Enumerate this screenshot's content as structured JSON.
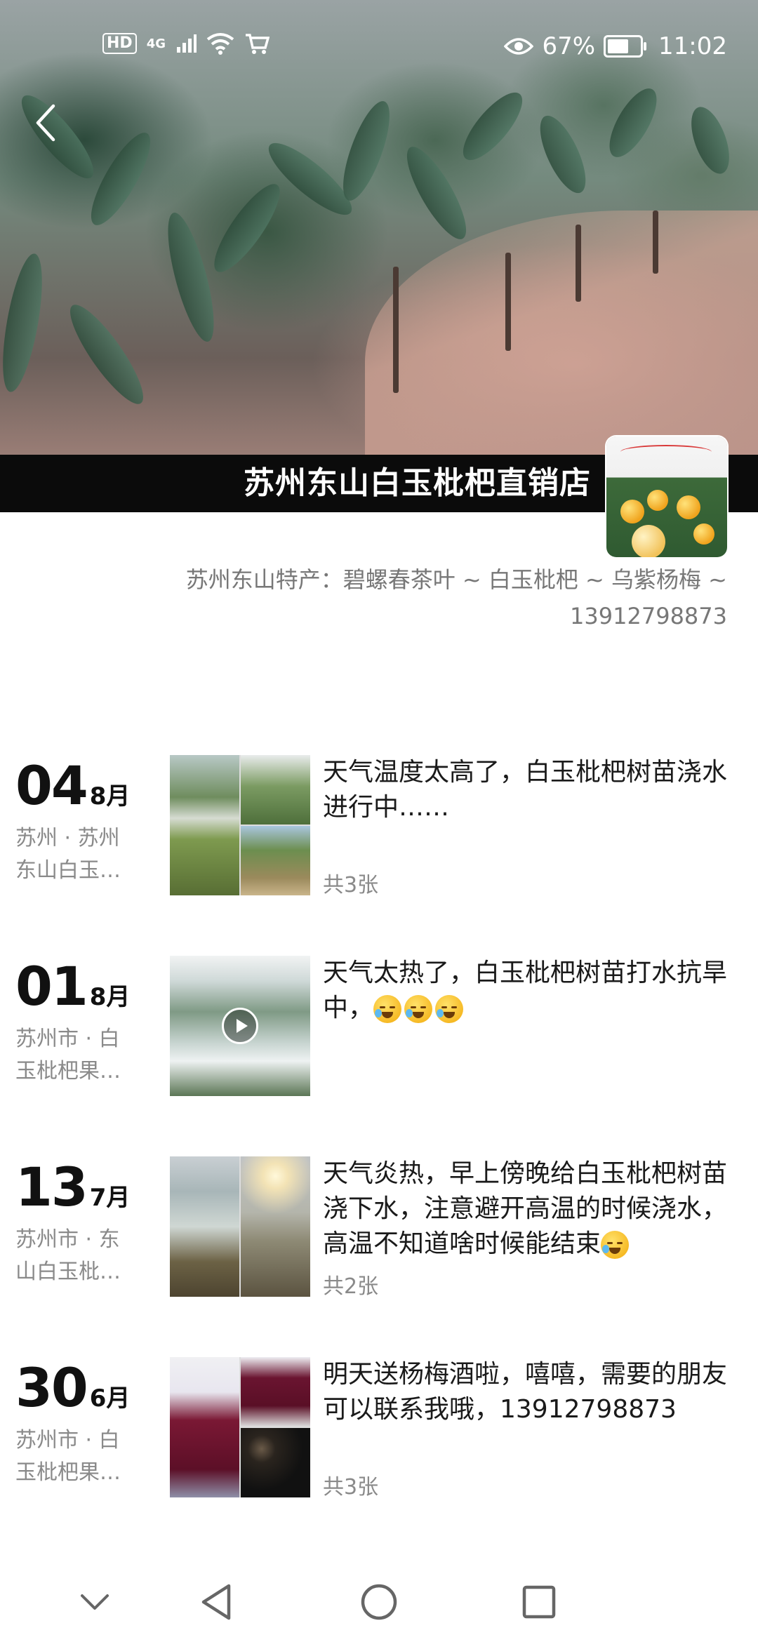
{
  "status_bar": {
    "hd": "HD",
    "network": "4G",
    "battery_percent": "67%",
    "battery_level": 0.67,
    "time": "11:02",
    "icons": [
      "hd-icon",
      "signal-icon",
      "wifi-icon",
      "cart-icon",
      "eye-icon",
      "battery-icon"
    ]
  },
  "header": {
    "back_icon": "back-arrow-icon",
    "shop_name": "苏州东山白玉枇杷直销店",
    "signature": "苏州东山特产：碧螺春茶叶 ~ 白玉枇杷 ~ 乌紫杨梅 ~ 13912798873"
  },
  "posts": [
    {
      "day": "04",
      "month": "8月",
      "location_line1": "苏州 · 苏州",
      "location_line2": "东山白玉…",
      "text": "天气温度太高了，白玉枇杷树苗浇水进行中……",
      "count": "共3张",
      "media": "photos"
    },
    {
      "day": "01",
      "month": "8月",
      "location_line1": "苏州市 · 白",
      "location_line2": "玉枇杷果…",
      "text": "天气太热了，白玉枇杷树苗打水抗旱中，",
      "emojis": 3,
      "count": "",
      "media": "video"
    },
    {
      "day": "13",
      "month": "7月",
      "location_line1": "苏州市 · 东",
      "location_line2": "山白玉枇…",
      "text": "天气炎热，早上傍晚给白玉枇杷树苗浇下水，注意避开高温的时候浇水，高温不知道啥时候能结束",
      "emojis": 1,
      "count": "共2张",
      "media": "photos"
    },
    {
      "day": "30",
      "month": "6月",
      "location_line1": "苏州市 · 白",
      "location_line2": "玉枇杷果…",
      "text": "明天送杨梅酒啦，嘻嘻，需要的朋友可以联系我哦，13912798873",
      "count": "共3张",
      "media": "photos"
    }
  ],
  "nav": {
    "icons": [
      "collapse-chevron-icon",
      "back-triangle-icon",
      "home-circle-icon",
      "recents-square-icon"
    ]
  }
}
